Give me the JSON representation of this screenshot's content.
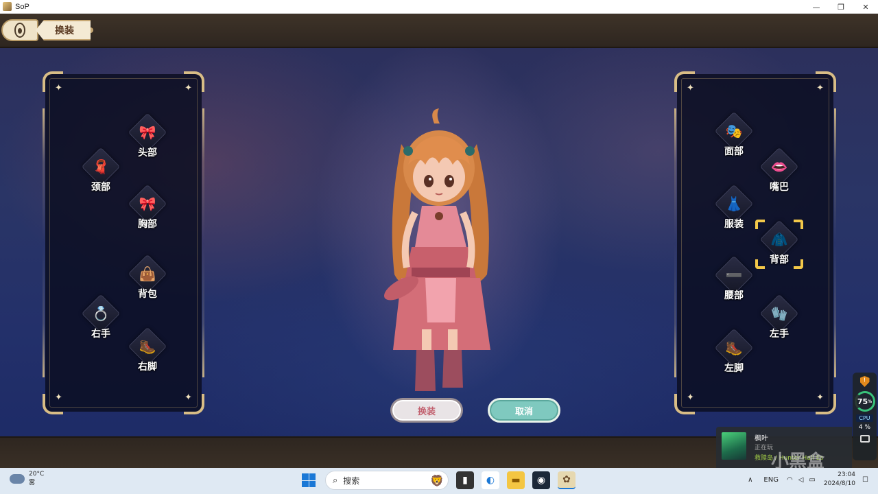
{
  "window": {
    "title": "SoP",
    "minimize": "—",
    "maximize": "❐",
    "close": "✕"
  },
  "header": {
    "tab_label": "换装"
  },
  "left_panel": {
    "slots": [
      {
        "label": "头部",
        "icon": "🎀"
      },
      {
        "label": "颈部",
        "icon": "🧣"
      },
      {
        "label": "胸部",
        "icon": "🎀"
      },
      {
        "label": "背包",
        "icon": "👜"
      },
      {
        "label": "右手",
        "icon": "💍"
      },
      {
        "label": "右脚",
        "icon": "🥾"
      }
    ]
  },
  "right_panel": {
    "slots": [
      {
        "label": "面部",
        "icon": "🎭"
      },
      {
        "label": "嘴巴",
        "icon": "👄"
      },
      {
        "label": "服装",
        "icon": "👗"
      },
      {
        "label": "背部",
        "icon": "🧥",
        "selected": true
      },
      {
        "label": "腰部",
        "icon": "➖"
      },
      {
        "label": "左手",
        "icon": "🧤"
      },
      {
        "label": "左脚",
        "icon": "🥾"
      }
    ]
  },
  "buttons": {
    "equip": "换装",
    "cancel": "取消"
  },
  "perf_overlay": {
    "shield": "!",
    "gauge_value": "75",
    "gauge_unit": "%",
    "cpu_label": "CPU",
    "cores": "4",
    "cores_unit": "%"
  },
  "notification": {
    "name": "枫叶",
    "status": "正在玩",
    "game": "救赎岛 / Hunter Hall Es"
  },
  "watermark": "小黑盒",
  "taskbar": {
    "weather_temp": "20°C",
    "weather_desc": "雾",
    "search_placeholder": "搜索",
    "lang": "ENG",
    "time": "23:04",
    "date": "2024/8/10"
  },
  "colors": {
    "accent_gold": "#d8bd86",
    "selected": "#f3c849",
    "cancel_btn": "#7fc9bf",
    "equip_text": "#c2616f"
  }
}
